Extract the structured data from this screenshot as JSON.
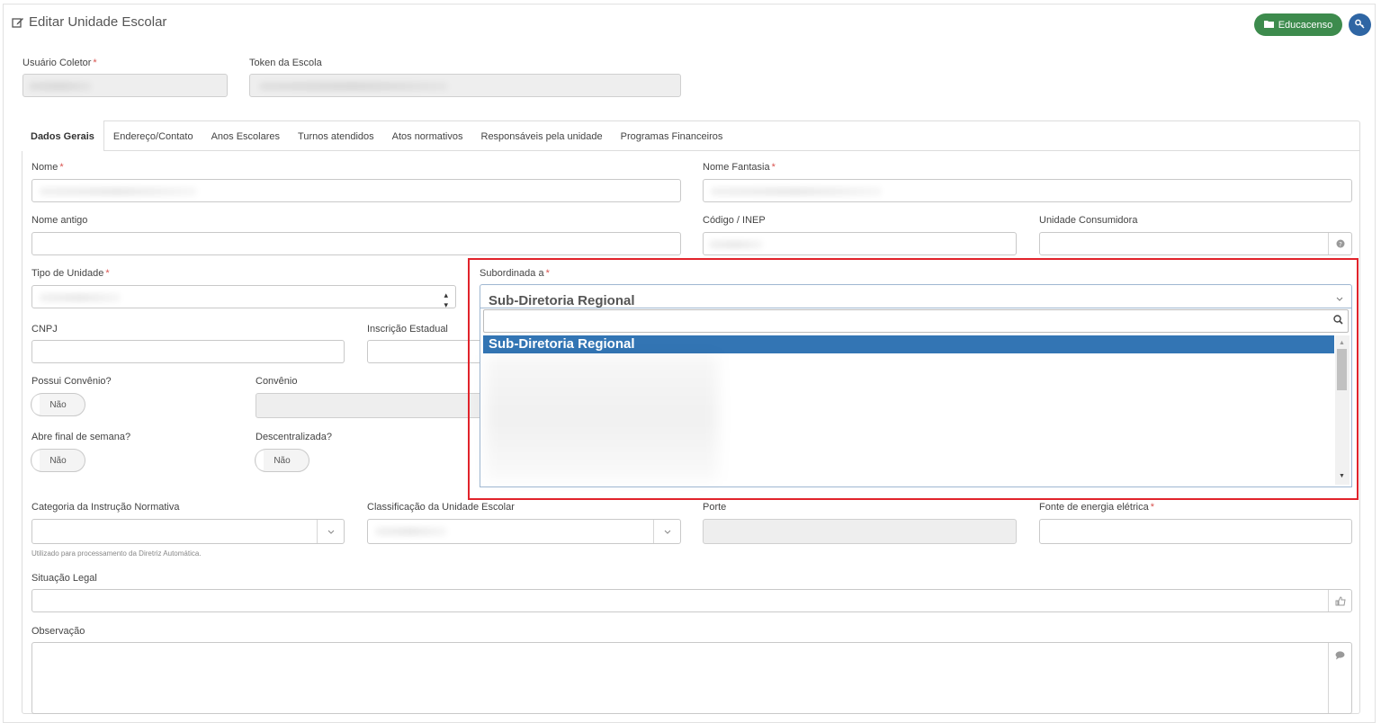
{
  "page": {
    "title": "Editar Unidade Escolar",
    "educacenso_label": "Educacenso"
  },
  "header_fields": {
    "usuario_coletor": "Usuário Coletor",
    "token_escola": "Token da Escola"
  },
  "tabs": [
    {
      "label": "Dados Gerais",
      "active": true
    },
    {
      "label": "Endereço/Contato"
    },
    {
      "label": "Anos Escolares"
    },
    {
      "label": "Turnos atendidos"
    },
    {
      "label": "Atos normativos"
    },
    {
      "label": "Responsáveis pela unidade"
    },
    {
      "label": "Programas Financeiros"
    }
  ],
  "form": {
    "nome": "Nome",
    "nome_fantasia": "Nome Fantasia",
    "nome_antigo": "Nome antigo",
    "codigo_inep": "Código / INEP",
    "unidade_consumidora": "Unidade Consumidora",
    "tipo_unidade": "Tipo de Unidade",
    "subordinada_a": "Subordinada a",
    "cnpj": "CNPJ",
    "inscricao_estadual": "Inscrição Estadual",
    "possui_convenio": "Possui Convênio?",
    "convenio": "Convênio",
    "abre_final_semana": "Abre final de semana?",
    "descentralizada": "Descentralizada?",
    "toggle_nao": "Não",
    "categoria_instrucao": "Categoria da Instrução Normativa",
    "categoria_hint": "Utilizado para processamento da Diretriz Automática.",
    "classificacao_unidade": "Classificação da Unidade Escolar",
    "porte": "Porte",
    "fonte_energia": "Fonte de energia elétrica",
    "situacao_legal": "Situação Legal",
    "observacao": "Observação"
  },
  "subordinada_dropdown": {
    "selected_value": "Sub-Diretoria Regional",
    "search_value": "",
    "highlighted_option": "Sub-Diretoria Regional"
  },
  "colors": {
    "educacenso_button": "#3d8b4d",
    "key_button": "#2f66a4",
    "selected_option": "#3375b4",
    "highlight_border": "#e1232b",
    "required_marker": "#d9534f"
  }
}
